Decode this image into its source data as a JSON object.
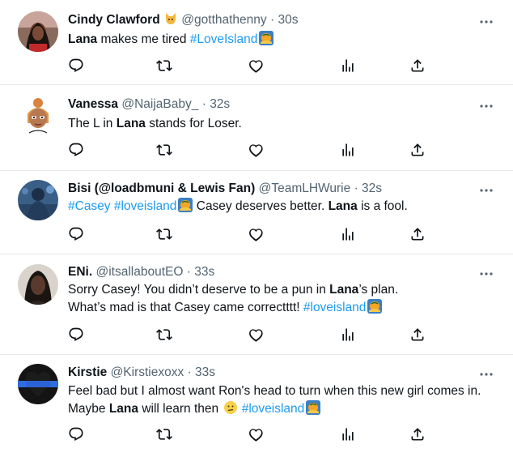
{
  "tweets": [
    {
      "name": "Cindy Clawford",
      "handle": "@gotthathenny",
      "time": "30s",
      "text_parts": [
        "Lana",
        " makes me tired  ",
        "#LoveIsland"
      ]
    },
    {
      "name": "Vanessa",
      "handle": "@NaijaBaby_",
      "time": "32s",
      "text_parts": [
        "The L in ",
        "Lana",
        " stands for Loser."
      ]
    },
    {
      "name": "Bisi (@loadbmuni & Lewis Fan)",
      "handle": "@TeamLHWurie",
      "time": "32s",
      "text_parts": [
        "#Casey",
        "#loveisland",
        "  Casey deserves better. ",
        "Lana",
        " is a fool."
      ]
    },
    {
      "name": "ENi.",
      "handle": "@itsallaboutEO",
      "time": "33s",
      "line1_parts": [
        "Sorry Casey! You didn’t deserve to be a pun in ",
        "Lana",
        "’s plan."
      ],
      "line2_parts": [
        "What’s mad is that Casey came correctttt! ",
        "#loveisland"
      ]
    },
    {
      "name": "Kirstie",
      "handle": "@Kirstiexoxx",
      "time": "33s",
      "line1": "Feel bad but I almost want Ron's head to turn when this new girl comes in.",
      "line2_parts": [
        "Maybe ",
        "Lana",
        " will learn then ",
        "#loveisland"
      ]
    }
  ],
  "separator": "·",
  "icons": [
    "reply-icon",
    "retweet-icon",
    "like-icon",
    "views-icon",
    "share-icon",
    "more-icon",
    "cat-emoji",
    "loveisland-emoji"
  ],
  "colors": {
    "link": "#1d9bf0",
    "muted": "#536471",
    "text": "#0f1419",
    "divider": "#e6e9ec"
  }
}
